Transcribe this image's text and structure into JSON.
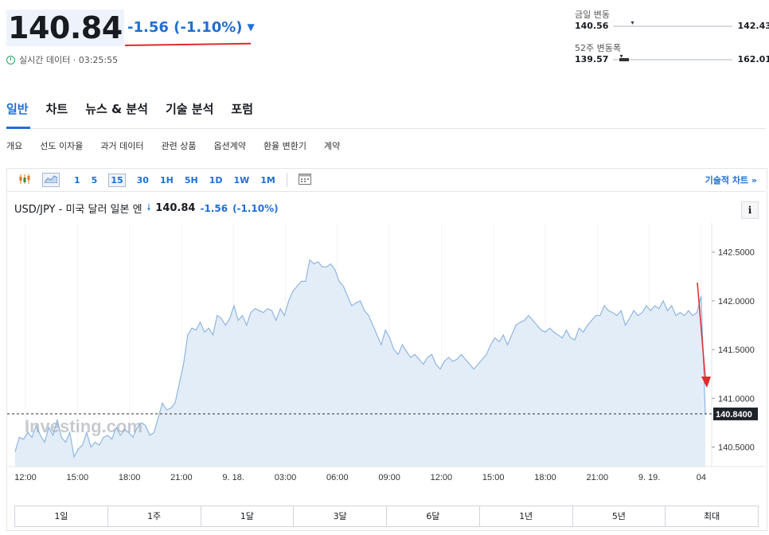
{
  "header": {
    "price": "140.84",
    "change": "-1.56 (-1.10%)",
    "realtime": "실시간 데이터 · 03:25:55"
  },
  "ranges": {
    "day": {
      "label": "금일 변동",
      "low": "140.56",
      "high": "142.43",
      "position": 0.15
    },
    "week52": {
      "label": "52주 변동폭",
      "low": "139.57",
      "high": "162.01",
      "position": 0.06
    }
  },
  "tabs": [
    "일반",
    "차트",
    "뉴스 & 분석",
    "기술 분석",
    "포럼"
  ],
  "subnav": [
    "개요",
    "선도 이자율",
    "과거 데이터",
    "관련 상품",
    "옵션계약",
    "환율 변환기",
    "계약"
  ],
  "toolbar": {
    "intervals": [
      "1",
      "5",
      "15",
      "30",
      "1H",
      "5H",
      "1D",
      "1W",
      "1M"
    ],
    "selected": "15",
    "technical_link": "기술적 차트 »"
  },
  "chart_header": {
    "pair": "USD/JPY - 미국 달러 일본 엔",
    "last": "140.84",
    "change": "-1.56",
    "change_pct": "(-1.10%)"
  },
  "periods": [
    "1일",
    "1주",
    "1달",
    "3달",
    "6달",
    "1년",
    "5년",
    "최대"
  ],
  "watermark": "Investing.com",
  "colors": {
    "accent": "#1f6fd6",
    "line": "#8fb6e0",
    "area": "#e3edf7",
    "annotation": "#e12a2a"
  },
  "chart_data": {
    "type": "area",
    "x_ticks": [
      "12:00",
      "15:00",
      "18:00",
      "21:00",
      "9. 18.",
      "03:00",
      "06:00",
      "09:00",
      "12:00",
      "15:00",
      "18:00",
      "21:00",
      "9. 19.",
      "04"
    ],
    "y_ticks": [
      "142.5000",
      "142.0000",
      "141.5000",
      "141.0000",
      "140.5000"
    ],
    "ylim": [
      140.3,
      142.8
    ],
    "last_value_label": "140.8400",
    "series": [
      {
        "values": [
          140.45,
          140.6,
          140.58,
          140.65,
          140.6,
          140.72,
          140.62,
          140.55,
          140.7,
          140.62,
          140.78,
          140.6,
          140.55,
          140.65,
          140.4,
          140.48,
          140.52,
          140.65,
          140.5,
          140.55,
          140.52,
          140.6,
          140.62,
          140.58,
          140.7,
          140.62,
          140.68,
          140.65,
          140.6,
          140.7,
          140.75,
          140.72,
          140.62,
          140.65,
          140.8,
          140.95,
          140.88,
          140.9,
          140.95,
          141.15,
          141.35,
          141.65,
          141.72,
          141.7,
          141.78,
          141.68,
          141.72,
          141.65,
          141.85,
          141.82,
          141.75,
          141.82,
          141.95,
          141.8,
          141.85,
          141.75,
          141.88,
          141.92,
          141.9,
          141.88,
          141.92,
          141.9,
          141.8,
          141.92,
          141.85,
          142.0,
          142.1,
          142.15,
          142.2,
          142.2,
          142.42,
          142.38,
          142.4,
          142.35,
          142.35,
          142.38,
          142.32,
          142.2,
          142.15,
          142.05,
          141.95,
          141.98,
          142.0,
          141.9,
          141.85,
          141.75,
          141.65,
          141.55,
          141.7,
          141.62,
          141.5,
          141.45,
          141.55,
          141.48,
          141.42,
          141.45,
          141.4,
          141.35,
          141.42,
          141.45,
          141.35,
          141.3,
          141.38,
          141.42,
          141.38,
          141.4,
          141.45,
          141.4,
          141.35,
          141.3,
          141.35,
          141.4,
          141.45,
          141.55,
          141.62,
          141.58,
          141.65,
          141.55,
          141.65,
          141.75,
          141.78,
          141.8,
          141.85,
          141.8,
          141.75,
          141.7,
          141.68,
          141.72,
          141.68,
          141.65,
          141.62,
          141.7,
          141.62,
          141.6,
          141.72,
          141.68,
          141.75,
          141.8,
          141.85,
          141.85,
          141.95,
          141.9,
          141.88,
          141.85,
          141.9,
          141.75,
          141.82,
          141.9,
          141.85,
          141.88,
          141.95,
          141.9,
          141.95,
          141.92,
          142.0,
          141.9,
          141.95,
          141.85,
          141.88,
          141.85,
          141.9,
          141.85,
          141.88,
          142.05,
          140.84
        ]
      }
    ]
  }
}
